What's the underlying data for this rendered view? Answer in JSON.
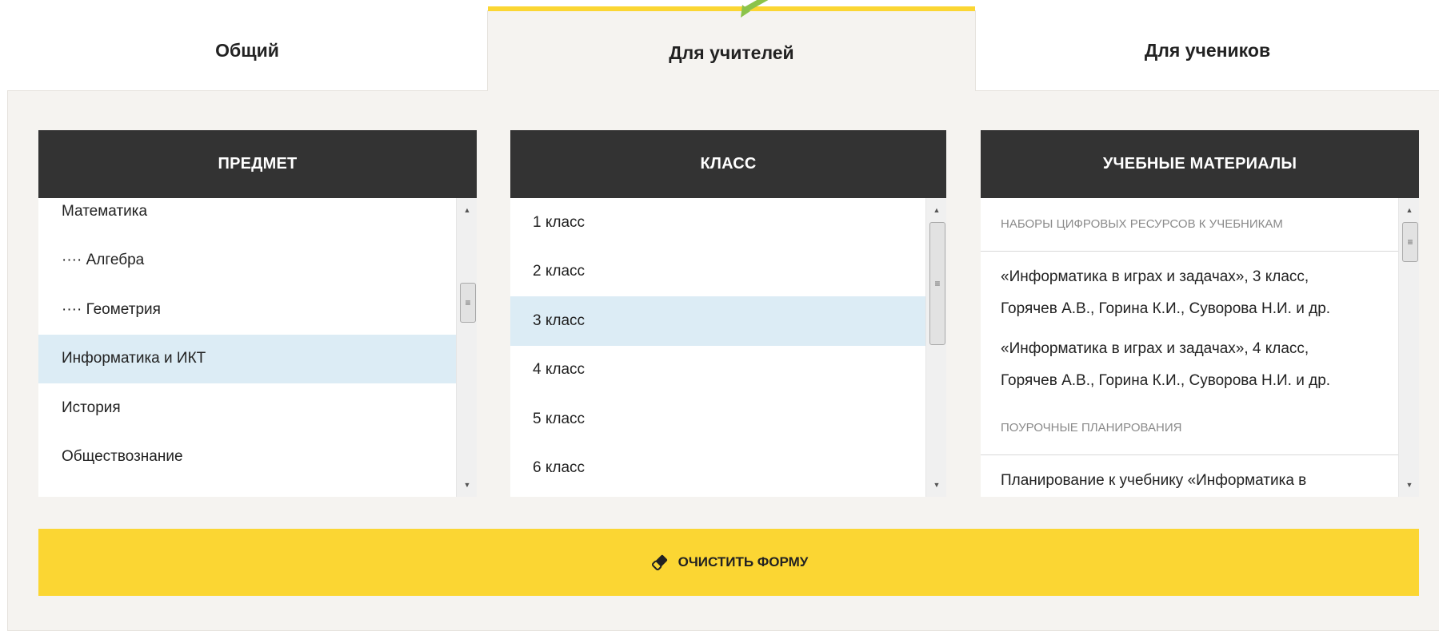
{
  "tabs": [
    {
      "label": "Общий"
    },
    {
      "label": "Для учителей",
      "active": true
    },
    {
      "label": "Для учеников"
    }
  ],
  "subject": {
    "header": "ПРЕДМЕТ",
    "items": [
      "Математика",
      "···· Алгебра",
      "···· Геометрия",
      "Информатика и ИКТ",
      "История",
      "Обществознание"
    ],
    "selected": "Информатика и ИКТ"
  },
  "grade": {
    "header": "КЛАСС",
    "items": [
      "1 класс",
      "2 класс",
      "3 класс",
      "4 класс",
      "5 класс",
      "6 класс"
    ],
    "selected": "3 класс"
  },
  "materials": {
    "header": "УЧЕБНЫЕ МАТЕРИАЛЫ",
    "section1": "НАБОРЫ ЦИФРОВЫХ РЕСУРСОВ К УЧЕБНИКАМ",
    "items1": [
      {
        "line1": "«Информатика в играх и задачах», 3 класс,",
        "line2": "Горячев А.В., Горина К.И., Суворова Н.И. и др."
      },
      {
        "line1": "«Информатика в играх и задачах», 4 класс,",
        "line2": "Горячев А.В., Горина К.И., Суворова Н.И. и др."
      }
    ],
    "section2": "ПОУРОЧНЫЕ ПЛАНИРОВАНИЯ",
    "items2": [
      "Планирование к учебнику «Информатика в"
    ]
  },
  "clear_button": {
    "label": "ОЧИСТИТЬ ФОРМУ",
    "icon": "eraser-icon"
  },
  "colors": {
    "accent": "#fbd633",
    "header_bg": "#333333",
    "selected_bg": "#dcecf5",
    "pointer_arrow": "#8bc34a"
  }
}
